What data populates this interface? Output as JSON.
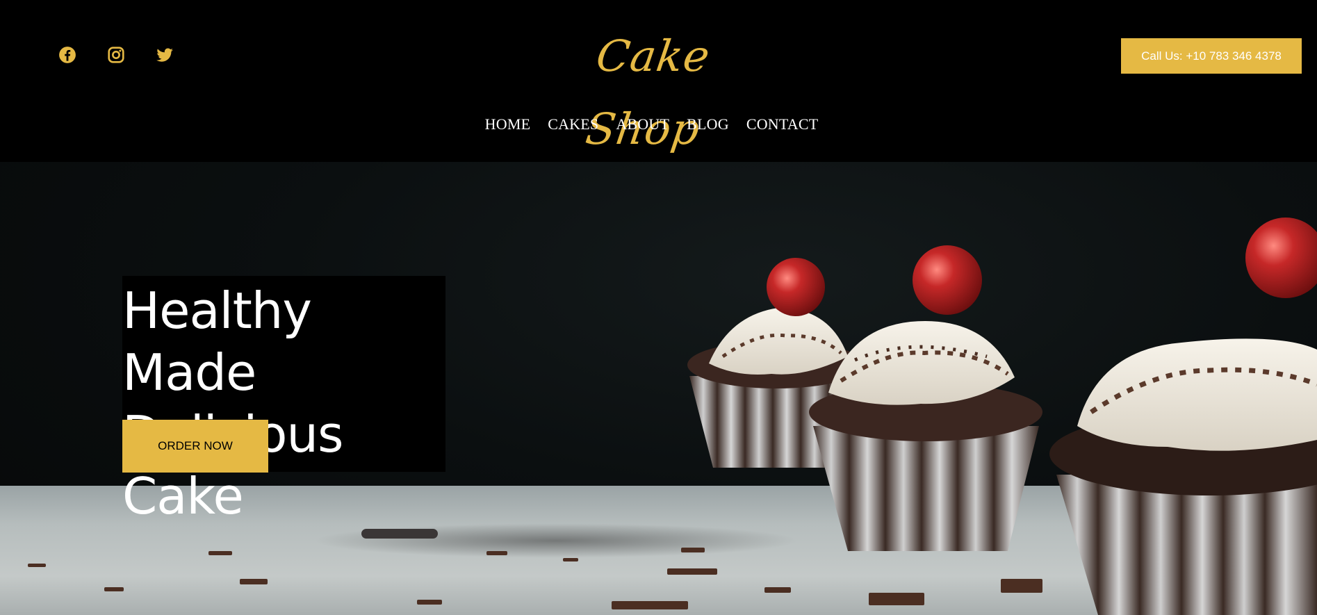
{
  "header": {
    "socials": [
      {
        "icon": "facebook-icon"
      },
      {
        "icon": "instagram-icon"
      },
      {
        "icon": "twitter-icon"
      }
    ],
    "logo_text": "Cake Shop",
    "call_label": "Call Us: +10 783 346 4378",
    "nav": [
      {
        "label": "HOME"
      },
      {
        "label": "CAKES"
      },
      {
        "label": "ABOUT"
      },
      {
        "label": "BLOG"
      },
      {
        "label": "CONTACT"
      }
    ]
  },
  "hero": {
    "title_line1": "Healthy Made",
    "title_line2": "Delicious Cake",
    "button_label": "ORDER NOW",
    "image": "cupcakes-photo"
  },
  "colors": {
    "accent": "#e5b944",
    "background": "#000000",
    "text_light": "#ffffff"
  }
}
